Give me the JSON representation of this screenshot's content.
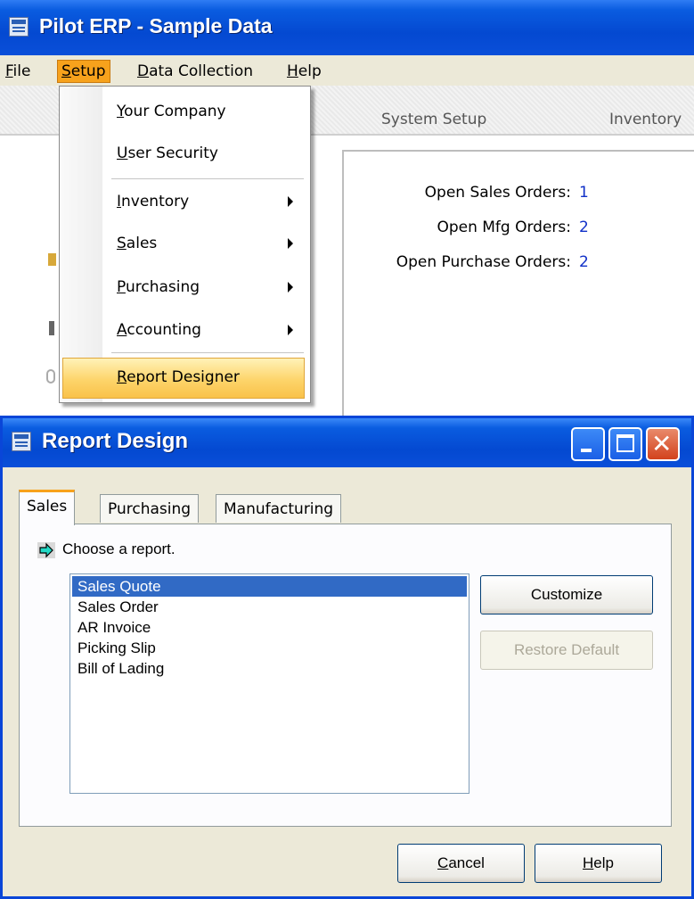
{
  "main_window": {
    "title": "Pilot ERP - Sample Data",
    "menu": [
      {
        "label": "File",
        "accel": "F",
        "rest": "ile"
      },
      {
        "label": "Setup",
        "accel": "S",
        "rest": "etup"
      },
      {
        "label": "Data Collection",
        "accel": "D",
        "rest": "ata Collection"
      },
      {
        "label": "Help",
        "accel": "H",
        "rest": "elp"
      }
    ],
    "tabs": [
      "System Setup",
      "Inventory"
    ],
    "summary": [
      {
        "label": "Open Sales Orders:",
        "value": "1"
      },
      {
        "label": "Open Mfg Orders:",
        "value": "2"
      },
      {
        "label": "Open Purchase Orders:",
        "value": "2"
      }
    ]
  },
  "setup_menu": {
    "items": [
      {
        "accel": "Y",
        "rest": "our Company"
      },
      {
        "accel": "U",
        "rest": "ser Security"
      },
      {
        "accel": "I",
        "rest": "nventory"
      },
      {
        "accel": "S",
        "rest": "ales"
      },
      {
        "accel": "P",
        "rest": "urchasing"
      },
      {
        "accel": "A",
        "rest": "ccounting"
      },
      {
        "accel": "R",
        "rest": "eport Designer"
      }
    ]
  },
  "dialog": {
    "title": "Report Design",
    "tabs": [
      "Sales",
      "Purchasing",
      "Manufacturing"
    ],
    "prompt": "Choose a report.",
    "reports": [
      "Sales Quote",
      "Sales Order",
      "AR Invoice",
      "Picking Slip",
      "Bill of Lading"
    ],
    "customize_label": "Customize",
    "restore_label": "Restore Default",
    "cancel": {
      "accel": "C",
      "rest": "ancel"
    },
    "help": {
      "accel": "H",
      "rest": "elp"
    }
  },
  "colors": {
    "menu_highlight": "#f7a21c",
    "title_blue": "#0449d1",
    "selection_blue": "#316ac5",
    "value_blue": "#1030c8"
  }
}
